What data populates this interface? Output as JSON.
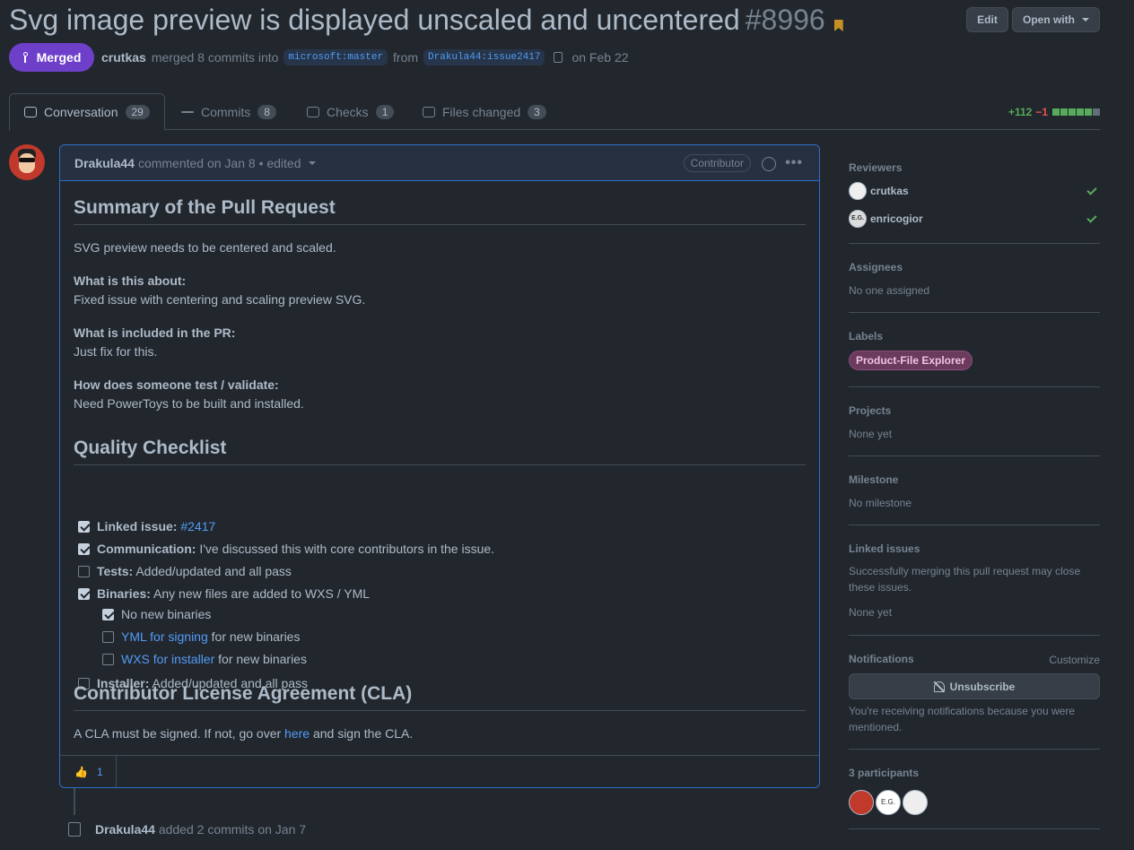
{
  "header": {
    "title": "Svg image preview is displayed unscaled and uncentered",
    "number": "#8996",
    "edit_label": "Edit",
    "open_with_label": "Open with",
    "state": "Merged",
    "author": "crutkas",
    "merged_text": "merged 8 commits into",
    "base_branch": "microsoft:master",
    "from_text": "from",
    "head_branch": "Drakula44:issue2417",
    "date_text": "on Feb 22"
  },
  "tabs": [
    {
      "label": "Conversation",
      "count": "29"
    },
    {
      "label": "Commits",
      "count": "8"
    },
    {
      "label": "Checks",
      "count": "1"
    },
    {
      "label": "Files changed",
      "count": "3"
    }
  ],
  "diffstat": {
    "additions": "+112",
    "deletions": "−1",
    "colors": [
      "#57ab5a",
      "#57ab5a",
      "#57ab5a",
      "#57ab5a",
      "#57ab5a",
      "#636e7b"
    ]
  },
  "comment": {
    "author": "Drakula44",
    "meta": "commented on Jan 8 • edited",
    "badge": "Contributor",
    "h_summary": "Summary of the Pull Request",
    "summary_text": "SVG preview needs to be centered and scaled.",
    "about_label": "What is this about:",
    "about_text": "Fixed issue with centering and scaling preview SVG.",
    "included_label": "What is included in the PR:",
    "included_text": "Just fix for this.",
    "test_label": "How does someone test / validate:",
    "test_text": "Need PowerToys to be built and installed.",
    "h_checklist": "Quality Checklist",
    "checklist": [
      {
        "bold": "Linked issue:",
        "text": " ",
        "link": "#2417",
        "after": "",
        "checked": true
      },
      {
        "bold": "Communication:",
        "text": " I've discussed this with core contributors in the issue.",
        "link": "",
        "after": "",
        "checked": true
      },
      {
        "bold": "Tests:",
        "text": " Added/updated and all pass",
        "link": "",
        "after": "",
        "checked": false
      },
      {
        "bold": "Binaries:",
        "text": " Any new files are added to WXS / YML",
        "link": "",
        "after": "",
        "checked": true
      },
      {
        "bold": "",
        "text": "No new binaries",
        "link": "",
        "after": "",
        "checked": true
      },
      {
        "bold": "",
        "text": "",
        "link": "YML for signing",
        "after": " for new binaries",
        "checked": false
      },
      {
        "bold": "",
        "text": "",
        "link": "WXS for installer",
        "after": " for new binaries",
        "checked": false
      },
      {
        "bold": "Installer:",
        "text": " Added/updated and all pass",
        "link": "",
        "after": "",
        "checked": false
      }
    ],
    "h_cla": "Contributor License Agreement (CLA)",
    "cla_before": "A CLA must be signed. If not, go over ",
    "cla_link": "here",
    "cla_after": " and sign the CLA.",
    "reaction_emoji": "👍",
    "reaction_count": "1"
  },
  "event": {
    "author": "Drakula44",
    "text": "added 2 commits",
    "date": "on Jan 7"
  },
  "sidebar": {
    "reviewers_title": "Reviewers",
    "reviewers": [
      {
        "name": "crutkas"
      },
      {
        "name": "enricogior"
      }
    ],
    "assignees_title": "Assignees",
    "assignees_text": "No one assigned",
    "labels_title": "Labels",
    "label": "Product-File Explorer",
    "projects_title": "Projects",
    "projects_text": "None yet",
    "milestone_title": "Milestone",
    "milestone_text": "No milestone",
    "linked_title": "Linked issues",
    "linked_desc": "Successfully merging this pull request may close these issues.",
    "linked_text": "None yet",
    "notifications_title": "Notifications",
    "customize": "Customize",
    "unsubscribe": "Unsubscribe",
    "notif_desc": "You're receiving notifications because you were mentioned.",
    "participants_title": "3 participants",
    "avatar_initials": "E.G."
  }
}
